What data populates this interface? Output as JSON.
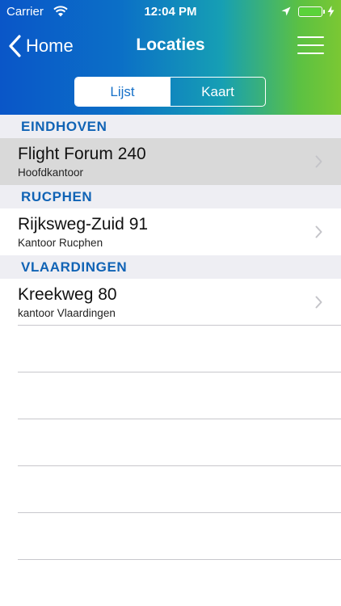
{
  "status_bar": {
    "carrier": "Carrier",
    "time": "12:04 PM"
  },
  "nav": {
    "back_label": "Home",
    "title": "Locaties"
  },
  "segments": {
    "list_label": "Lijst",
    "map_label": "Kaart",
    "selected": "Lijst"
  },
  "sections": [
    {
      "header": "EINDHOVEN",
      "items": [
        {
          "title": "Flight Forum 240",
          "subtitle": "Hoofdkantoor",
          "selected": true
        }
      ]
    },
    {
      "header": "RUCPHEN",
      "items": [
        {
          "title": "Rijksweg-Zuid 91",
          "subtitle": "Kantoor Rucphen",
          "selected": false
        }
      ]
    },
    {
      "header": "VLAARDINGEN",
      "items": [
        {
          "title": "Kreekweg 80",
          "subtitle": "kantoor Vlaardingen",
          "selected": false
        }
      ]
    }
  ],
  "colors": {
    "accent": "#1063b5",
    "header_gradient_start": "#0a56c8",
    "header_gradient_end": "#7bc833",
    "battery": "#5ad33a"
  },
  "icons": [
    "wifi-icon",
    "location-arrow-icon",
    "battery-icon",
    "charging-bolt-icon",
    "back-chevron-icon",
    "hamburger-menu-icon",
    "disclosure-chevron-icon"
  ]
}
